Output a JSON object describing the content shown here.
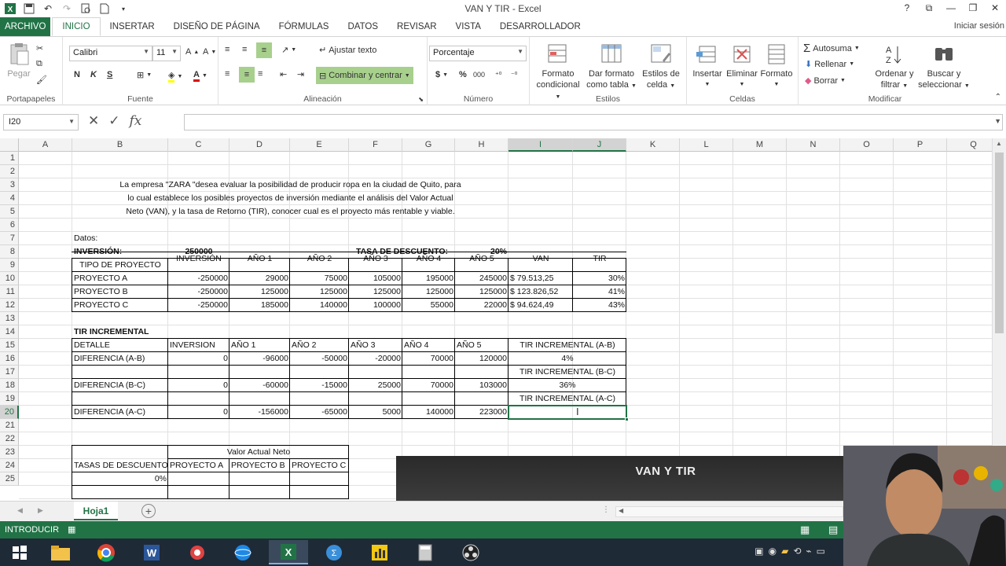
{
  "window": {
    "title": "VAN Y TIR - Excel",
    "signin": "Iniciar sesión"
  },
  "tabs": [
    "ARCHIVO",
    "INICIO",
    "INSERTAR",
    "DISEÑO DE PÁGINA",
    "FÓRMULAS",
    "DATOS",
    "REVISAR",
    "VISTA",
    "DESARROLLADOR"
  ],
  "ribbon": {
    "paste": "Pegar",
    "portapapeles": "Portapapeles",
    "font_name": "Calibri",
    "font_size": "11",
    "fuente": "Fuente",
    "bold": "N",
    "italic": "K",
    "underline": "S",
    "ajustar": "Ajustar texto",
    "combinar": "Combinar y centrar",
    "alineacion": "Alineación",
    "num_format": "Porcentaje",
    "currency": "$",
    "percent": "%",
    "thousands": "000",
    "numero": "Número",
    "formato_condicional_1": "Formato",
    "formato_condicional_2": "condicional",
    "dar_formato_1": "Dar formato",
    "dar_formato_2": "como tabla",
    "estilos_celda_1": "Estilos de",
    "estilos_celda_2": "celda",
    "estilos": "Estilos",
    "insertar": "Insertar",
    "eliminar": "Eliminar",
    "formato": "Formato",
    "celdas": "Celdas",
    "autosuma": "Autosuma",
    "rellenar": "Rellenar",
    "borrar": "Borrar",
    "ordenar_1": "Ordenar y",
    "ordenar_2": "filtrar",
    "buscar_1": "Buscar y",
    "buscar_2": "seleccionar",
    "modificar": "Modificar"
  },
  "formula_bar": {
    "name_box": "I20",
    "fx": "fx",
    "formula": ""
  },
  "columns": [
    "A",
    "B",
    "C",
    "D",
    "E",
    "F",
    "G",
    "H",
    "I",
    "J",
    "K",
    "L",
    "M",
    "N",
    "O",
    "P",
    "Q"
  ],
  "rows": [
    "1",
    "2",
    "3",
    "4",
    "5",
    "6",
    "7",
    "8",
    "9",
    "10",
    "11",
    "12",
    "13",
    "14",
    "15",
    "16",
    "17",
    "18",
    "19",
    "20",
    "21",
    "22",
    "23",
    "24",
    "25"
  ],
  "sheet": {
    "intro_1": "La empresa \"ZARA \"desea evaluar la posibilidad de producir ropa en la ciudad de Quito, para",
    "intro_2": "lo cual establece los posibles proyectos de inversión mediante el análisis del Valor Actual",
    "intro_3": "Neto (VAN), y la tasa de Retorno (TIR), conocer cual es el proyecto más rentable y viable.",
    "datos": "Datos:",
    "inversion_label": "INVERSIÓN:",
    "inversion_value": "250000",
    "tasa_label": "TASA DE DESCUENTO:",
    "tasa_value": "20%",
    "table1_headers": [
      "TIPO DE PROYECTO",
      "INVERSIÓN",
      "AÑO 1",
      "AÑO 2",
      "AÑO 3",
      "AÑO 4",
      "AÑO 5",
      "VAN",
      "TIR"
    ],
    "table1_rows": [
      [
        "PROYECTO A",
        "-250000",
        "29000",
        "75000",
        "105000",
        "195000",
        "245000",
        "$ 79.513,25",
        "30%"
      ],
      [
        "PROYECTO B",
        "-250000",
        "125000",
        "125000",
        "125000",
        "125000",
        "125000",
        "$ 123.826,52",
        "41%"
      ],
      [
        "PROYECTO C",
        "-250000",
        "185000",
        "140000",
        "100000",
        "55000",
        "22000",
        "$ 94.624,49",
        "43%"
      ]
    ],
    "tir_incremental_title": "TIR INCREMENTAL",
    "table2_headers": [
      "DETALLE",
      "INVERSION",
      "AÑO 1",
      "AÑO 2",
      "AÑO 3",
      "AÑO 4",
      "AÑO 5",
      "TIR INCREMENTAL (A-B)"
    ],
    "table2_rows": [
      [
        "DIFERENCIA (A-B)",
        "0",
        "-96000",
        "-50000",
        "-20000",
        "70000",
        "120000",
        "4%"
      ],
      [
        "DIFERENCIA (B-C)",
        "0",
        "-60000",
        "-15000",
        "25000",
        "70000",
        "103000",
        "36%"
      ],
      [
        "DIFERENCIA (A-C)",
        "0",
        "-156000",
        "-65000",
        "5000",
        "140000",
        "223000",
        ""
      ]
    ],
    "tir_bc_label": "TIR INCREMENTAL (B-C)",
    "tir_ac_label": "TIR INCREMENTAL (A-C)",
    "valor_actual_neto": "Valor Actual Neto",
    "tasas_descuento": "TASAS DE DESCUENTO",
    "proyecto_a": "PROYECTO A",
    "proyecto_b": "PROYECTO B",
    "proyecto_c": "PROYECTO C",
    "tasa_row_25": "0%"
  },
  "sheet_tab": "Hoja1",
  "status": "INTRODUCIR",
  "overlay_title": "VAN Y TIR"
}
